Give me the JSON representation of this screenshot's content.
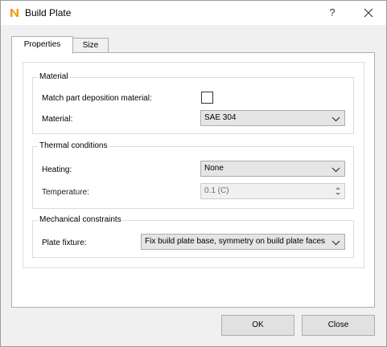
{
  "window": {
    "title": "Build Plate",
    "help_label": "?",
    "app_icon": "n-logo-icon",
    "close_icon": "close-icon"
  },
  "tabs": [
    {
      "label": "Properties",
      "active": true
    },
    {
      "label": "Size",
      "active": false
    }
  ],
  "material": {
    "group_title": "Material",
    "match_label": "Match part deposition material:",
    "match_checked": false,
    "material_label": "Material:",
    "material_value": "SAE 304"
  },
  "thermal": {
    "group_title": "Thermal conditions",
    "heating_label": "Heating:",
    "heating_value": "None",
    "temperature_label": "Temperature:",
    "temperature_value": "0.1 (C)"
  },
  "mechanical": {
    "group_title": "Mechanical constraints",
    "fixture_label": "Plate fixture:",
    "fixture_value": "Fix build plate base, symmetry on build plate faces"
  },
  "buttons": {
    "ok": "OK",
    "close": "Close"
  },
  "colors": {
    "accent_orange": "#f39c12",
    "dialog_bg": "#f0f0f0",
    "combo_bg": "#e5e5e5"
  }
}
